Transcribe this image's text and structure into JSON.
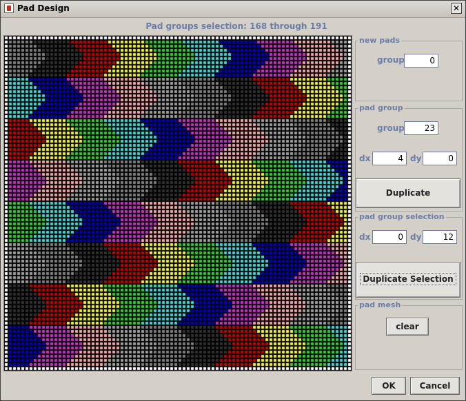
{
  "window": {
    "title": "Pad Design",
    "close_glyph": "✕",
    "icon": "java-cup-icon"
  },
  "header": {
    "selection_text": "Pad groups selection: 168 through 191"
  },
  "new_pads": {
    "title": "new pads",
    "group_label": "group",
    "group_value": "0"
  },
  "pad_group": {
    "title": "pad group",
    "group_label": "group",
    "group_value": "23",
    "dx_label": "dx",
    "dx_value": "4",
    "dy_label": "dy",
    "dy_value": "0",
    "duplicate_label": "Duplicate"
  },
  "pad_group_selection": {
    "title": "pad group selection",
    "dx_label": "dx",
    "dx_value": "0",
    "dy_label": "dy",
    "dy_value": "12",
    "duplicate_selection_label": "Duplicate Selection"
  },
  "pad_mesh": {
    "title": "pad mesh",
    "clear_label": "clear"
  },
  "footer": {
    "ok_label": "OK",
    "cancel_label": "Cancel"
  },
  "pad_grid": {
    "cols": 84,
    "rows": 81,
    "band_rows": 10,
    "chevron_width": 9,
    "chevron_depth": 4,
    "palette": [
      "#808080",
      "#303030",
      "#c80000",
      "#f4f430",
      "#30d030",
      "#40d8d8",
      "#0000c8",
      "#c830c8",
      "#f0a8a8",
      "#a0a0a0"
    ],
    "band_offsets": [
      0,
      5,
      2,
      7,
      4,
      9,
      1,
      6,
      3
    ]
  }
}
